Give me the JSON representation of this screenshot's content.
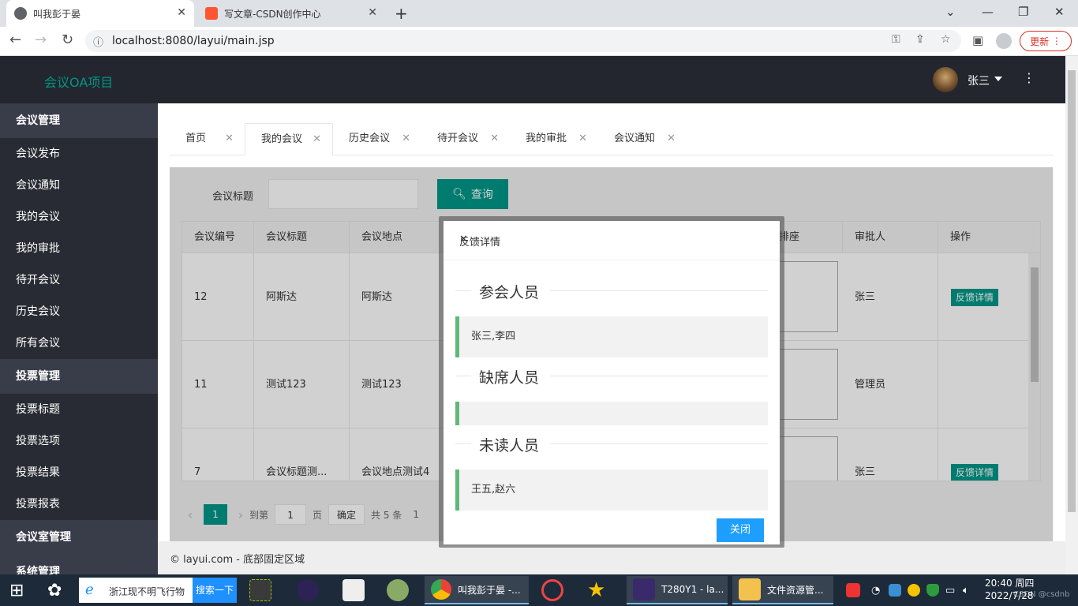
{
  "browser": {
    "tabs": [
      {
        "title": "叫我彭于晏"
      },
      {
        "title": "写文章-CSDN创作中心"
      }
    ],
    "url": "localhost:8080/layui/main.jsp",
    "update_label": "更新"
  },
  "app": {
    "title": "会议OA项目",
    "user": "张三"
  },
  "sidebar": {
    "groups": [
      {
        "label": "会议管理",
        "items": [
          "会议发布",
          "会议通知",
          "我的会议",
          "我的审批",
          "待开会议",
          "历史会议",
          "所有会议"
        ]
      },
      {
        "label": "投票管理",
        "items": [
          "投票标题",
          "投票选项",
          "投票结果",
          "投票报表"
        ]
      },
      {
        "label": "会议室管理",
        "items": []
      },
      {
        "label": "系统管理",
        "items": []
      }
    ]
  },
  "page_tabs": [
    "首页",
    "我的会议",
    "历史会议",
    "待开会议",
    "我的审批",
    "会议通知"
  ],
  "search": {
    "label": "会议标题",
    "button": "查询"
  },
  "table": {
    "headers": [
      "会议编号",
      "会议标题",
      "会议地点",
      "排座",
      "审批人",
      "操作"
    ],
    "rows": [
      {
        "id": "12",
        "title": "阿斯达",
        "place": "阿斯达",
        "approver": "张三",
        "action": "反馈详情"
      },
      {
        "id": "11",
        "title": "测试123",
        "place": "测试123",
        "approver": "管理员",
        "action": ""
      },
      {
        "id": "7",
        "title": "会议标题测...",
        "place": "会议地点测试4",
        "approver": "张三",
        "action": "反馈详情"
      }
    ]
  },
  "pager": {
    "current": "1",
    "goto_label": "到第",
    "page_input": "1",
    "page_unit": "页",
    "confirm": "确定",
    "total": "共 5 条",
    "after_total": "1"
  },
  "footer": "© layui.com - 底部固定区域",
  "modal": {
    "title": "反馈详情",
    "sections": [
      {
        "legend": "参会人员",
        "content": "张三,李四"
      },
      {
        "legend": "缺席人员",
        "content": ""
      },
      {
        "legend": "未读人员",
        "content": "王五,赵六"
      }
    ],
    "close_label": "关闭"
  },
  "taskbar": {
    "news": "浙江现不明飞行物",
    "search_btn": "搜索一下",
    "apps": [
      {
        "label": "叫我彭于晏 -..."
      },
      {
        "label": "T280Y1 - la..."
      },
      {
        "label": "文件资源管..."
      }
    ],
    "time": "20:40 周四",
    "date": "2022/7/28",
    "watermark": "CSDN @csdnb"
  },
  "colors": {
    "accent": "#009688",
    "header": "#23262e",
    "sidebar": "#393d49",
    "quote": "#5fb878",
    "close_btn": "#1e9fff"
  }
}
